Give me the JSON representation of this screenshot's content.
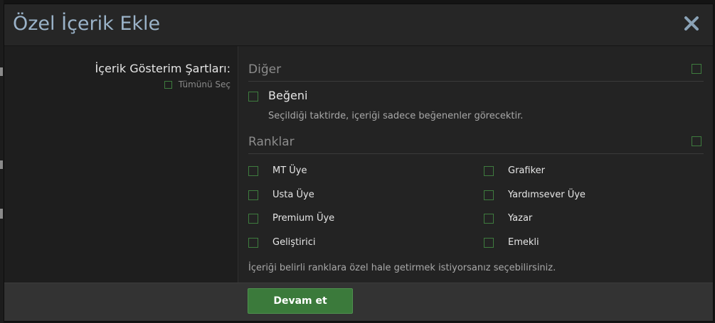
{
  "dialog": {
    "title": "Özel İçerik Ekle",
    "close_icon": "close-icon"
  },
  "conditions": {
    "label": "İçerik Gösterim Şartları:",
    "select_all": "Tümünü Seç"
  },
  "sections": {
    "other": {
      "title": "Diğer",
      "like_label": "Beğeni",
      "like_description": "Seçildiği taktirde, içeriği sadece beğenenler görecektir."
    },
    "ranks": {
      "title": "Ranklar",
      "items": [
        {
          "label": "MT Üye",
          "checked": false
        },
        {
          "label": "Grafiker",
          "checked": false
        },
        {
          "label": "Usta Üye",
          "checked": false
        },
        {
          "label": "Yardımsever Üye",
          "checked": false
        },
        {
          "label": "Premium Üye",
          "checked": false
        },
        {
          "label": "Yazar",
          "checked": false
        },
        {
          "label": "Geliştirici",
          "checked": false
        },
        {
          "label": "Emekli",
          "checked": false
        }
      ],
      "note": "İçeriği belirli ranklara özel hale getirmek istiyorsanız seçebilirsiniz."
    }
  },
  "footer": {
    "continue_label": "Devam et"
  },
  "colors": {
    "title": "#9ab2c8",
    "accent_green": "#3b7a3b",
    "checkbox_border": "#3e7c3e"
  }
}
